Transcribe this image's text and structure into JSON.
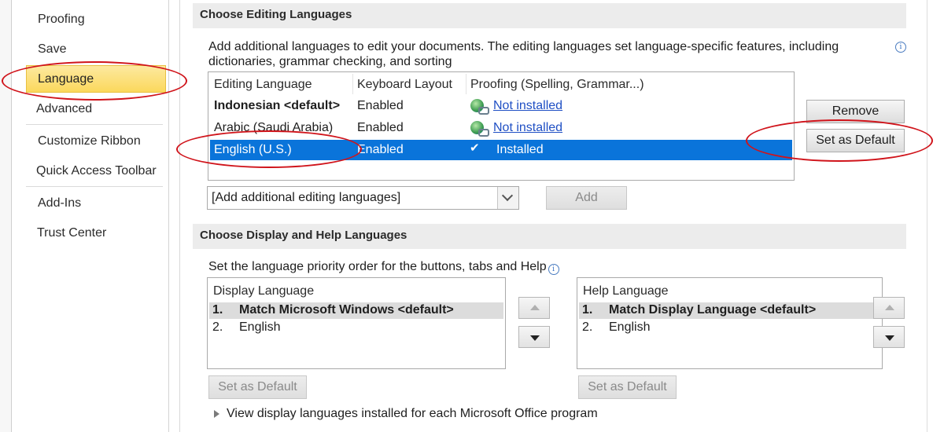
{
  "sidebar": {
    "items": [
      {
        "label": "Proofing"
      },
      {
        "label": "Save"
      },
      {
        "label": "Language"
      },
      {
        "label": "Advanced"
      },
      {
        "label": "Customize Ribbon"
      },
      {
        "label": "Quick Access Toolbar"
      },
      {
        "label": "Add-Ins"
      },
      {
        "label": "Trust Center"
      }
    ],
    "selected": "Language"
  },
  "editing": {
    "section_title": "Choose Editing Languages",
    "description": "Add additional languages to edit your documents. The editing languages set language-specific features, including dictionaries, grammar checking, and sorting",
    "columns": [
      "Editing Language",
      "Keyboard Layout",
      "Proofing (Spelling, Grammar...)"
    ],
    "rows": [
      {
        "language": "Indonesian <default>",
        "keyboard": "Enabled",
        "proofing": "Not installed",
        "bold": true
      },
      {
        "language": "Arabic (Saudi Arabia)",
        "keyboard": "Enabled",
        "proofing": "Not installed"
      },
      {
        "language": "English (U.S.)",
        "keyboard": "Enabled",
        "proofing": "Installed",
        "selected": true
      }
    ],
    "remove_label": "Remove",
    "set_default_label": "Set as Default",
    "add_dropdown_value": "[Add additional editing languages]",
    "add_label": "Add"
  },
  "display": {
    "section_title": "Choose Display and Help Languages",
    "description": "Set the language priority order for the buttons, tabs and Help",
    "display_list": {
      "header": "Display Language",
      "items": [
        {
          "num": "1.",
          "label": "Match Microsoft Windows <default>"
        },
        {
          "num": "2.",
          "label": "English"
        }
      ]
    },
    "help_list": {
      "header": "Help Language",
      "items": [
        {
          "num": "1.",
          "label": "Match Display Language <default>"
        },
        {
          "num": "2.",
          "label": "English"
        }
      ]
    },
    "set_default_label": "Set as Default",
    "expander_label": "View display languages installed for each Microsoft Office program"
  },
  "colors": {
    "selection_blue": "#0a74da",
    "nav_selected": "#fbd85c",
    "annotation_red": "#d0141b",
    "link_blue": "#1f4fc4"
  }
}
